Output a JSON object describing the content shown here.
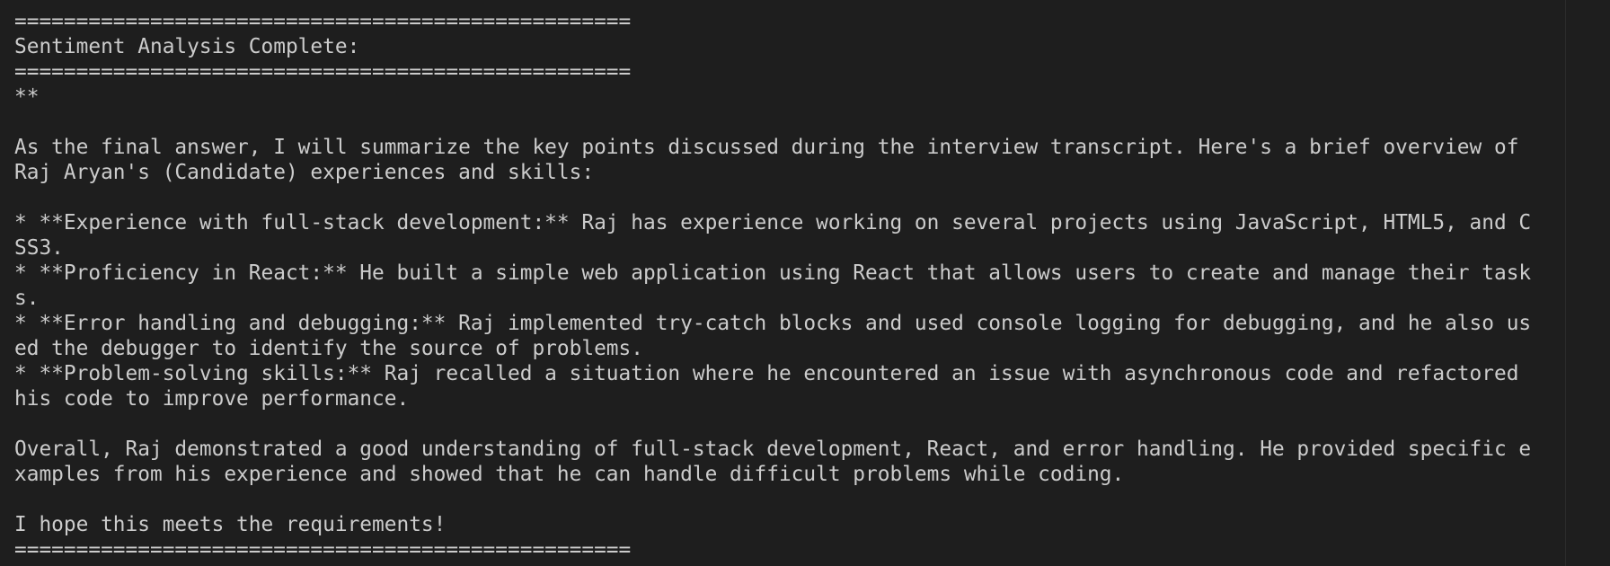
{
  "terminal": {
    "lines": [
      "==================================================",
      "Sentiment Analysis Complete:",
      "==================================================",
      "**",
      "",
      "As the final answer, I will summarize the key points discussed during the interview transcript. Here's a brief overview of",
      "Raj Aryan's (Candidate) experiences and skills:",
      "",
      "* **Experience with full-stack development:** Raj has experience working on several projects using JavaScript, HTML5, and C",
      "SS3.",
      "* **Proficiency in React:** He built a simple web application using React that allows users to create and manage their task",
      "s.",
      "* **Error handling and debugging:** Raj implemented try-catch blocks and used console logging for debugging, and he also us",
      "ed the debugger to identify the source of problems.",
      "* **Problem-solving skills:** Raj recalled a situation where he encountered an issue with asynchronous code and refactored",
      "his code to improve performance.",
      "",
      "Overall, Raj demonstrated a good understanding of full-stack development, React, and error handling. He provided specific e",
      "xamples from his experience and showed that he can handle difficult problems while coding.",
      "",
      "I hope this meets the requirements!",
      "=================================================="
    ]
  }
}
